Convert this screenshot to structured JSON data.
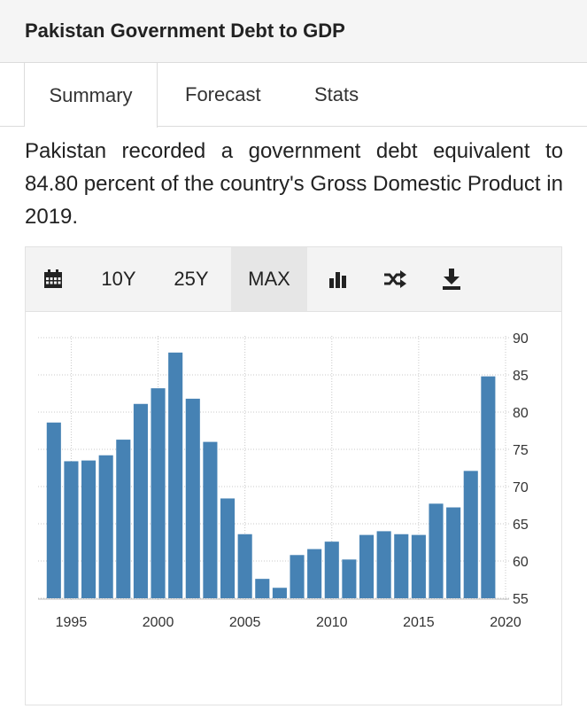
{
  "page": {
    "title": "Pakistan Government Debt to GDP"
  },
  "tabs": [
    {
      "label": "Summary",
      "active": true
    },
    {
      "label": "Forecast",
      "active": false
    },
    {
      "label": "Stats",
      "active": false
    }
  ],
  "summary_text": "Pakistan recorded a government debt equivalent to 84.80 percent of the country's Gross Domestic Product in 2019.",
  "toolbar": {
    "calendar_icon": "calendar-icon",
    "ranges": [
      "10Y",
      "25Y",
      "MAX"
    ],
    "active_range": "MAX",
    "icons": [
      "bar-chart-icon",
      "shuffle-icon",
      "download-icon"
    ]
  },
  "colors": {
    "bar": "#4682b4",
    "grid": "#c8c8c8",
    "tab_border": "#dcdcdc"
  },
  "chart_data": {
    "type": "bar",
    "title": "",
    "xlabel": "",
    "ylabel": "",
    "x": [
      1994,
      1995,
      1996,
      1997,
      1998,
      1999,
      2000,
      2001,
      2002,
      2003,
      2004,
      2005,
      2006,
      2007,
      2008,
      2009,
      2010,
      2011,
      2012,
      2013,
      2014,
      2015,
      2016,
      2017,
      2018,
      2019
    ],
    "values": [
      78.6,
      73.4,
      73.5,
      74.2,
      76.3,
      81.1,
      83.2,
      88.0,
      81.8,
      76.0,
      68.4,
      63.6,
      57.6,
      56.4,
      60.8,
      61.6,
      62.6,
      60.2,
      63.5,
      64.0,
      63.6,
      63.5,
      67.7,
      67.2,
      72.1,
      84.8
    ],
    "xticks": [
      "1995",
      "2000",
      "2005",
      "2010",
      "2015",
      "2020"
    ],
    "yticks": [
      "55",
      "60",
      "65",
      "70",
      "75",
      "80",
      "85",
      "90"
    ],
    "ylim": [
      55,
      90
    ],
    "xlim": [
      1993.5,
      2020
    ],
    "y_axis_side": "right",
    "grid": true
  }
}
